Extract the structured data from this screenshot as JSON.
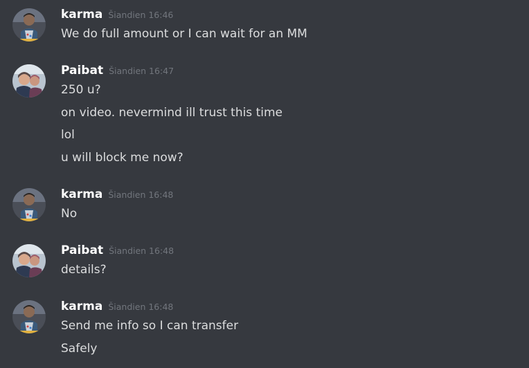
{
  "messages": [
    {
      "author": "karma",
      "timestamp": "Šiandien 16:46",
      "avatar": "karma-avatar",
      "lines": [
        "We do full amount or I can wait for an MM"
      ]
    },
    {
      "author": "Paibat",
      "timestamp": "Šiandien 16:47",
      "avatar": "paibat-avatar",
      "lines": [
        "250 u?",
        "on video. nevermind ill trust this time",
        "lol",
        "u will block me now?"
      ]
    },
    {
      "author": "karma",
      "timestamp": "Šiandien 16:48",
      "avatar": "karma-avatar",
      "lines": [
        "No"
      ]
    },
    {
      "author": "Paibat",
      "timestamp": "Šiandien 16:48",
      "avatar": "paibat-avatar",
      "lines": [
        "details?"
      ]
    },
    {
      "author": "karma",
      "timestamp": "Šiandien 16:48",
      "avatar": "karma-avatar",
      "lines": [
        "Send me info so I can transfer",
        "Safely"
      ]
    }
  ],
  "colors": {
    "background": "#36393f",
    "username": "#ffffff",
    "message_text": "#dcddde",
    "timestamp": "#72767d"
  }
}
